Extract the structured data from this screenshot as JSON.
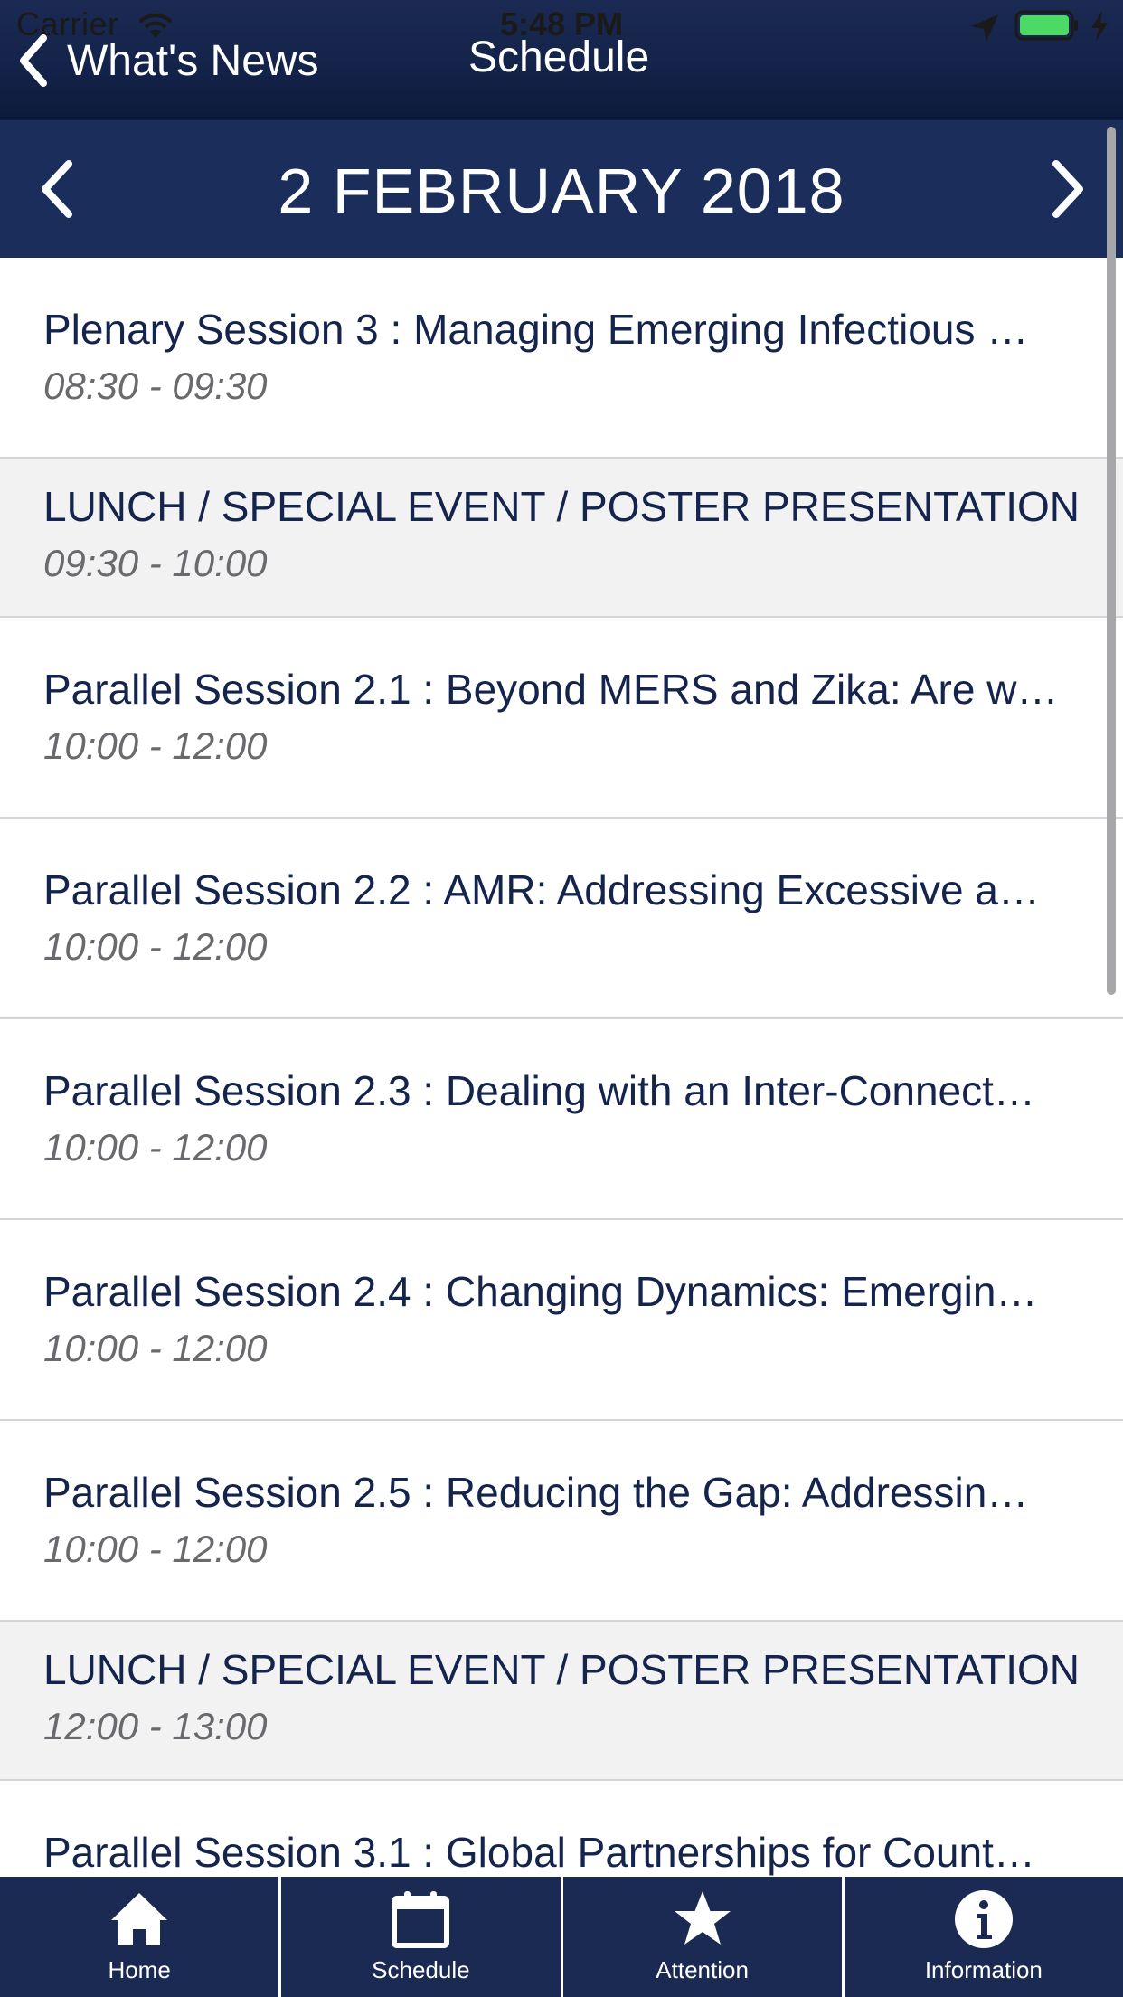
{
  "status_bar": {
    "carrier": "Carrier",
    "time": "5:48 PM",
    "battery_color": "#4cd964"
  },
  "nav": {
    "back_label": "What's News",
    "title": "Schedule",
    "back_icon": "chevron-left-icon"
  },
  "date_selector": {
    "label": "2 FEBRUARY 2018",
    "prev_icon": "chevron-left-icon",
    "next_icon": "chevron-right-icon"
  },
  "schedule": [
    {
      "kind": "session",
      "title": "Plenary Session 3 : Managing Emerging Infectious …",
      "time": "08:30 - 09:30"
    },
    {
      "kind": "break",
      "title": "LUNCH / SPECIAL EVENT / POSTER PRESENTATION",
      "time": "09:30 - 10:00"
    },
    {
      "kind": "session",
      "title": "Parallel Session 2.1 : Beyond MERS and Zika: Are w…",
      "time": "10:00 - 12:00"
    },
    {
      "kind": "session",
      "title": "Parallel Session 2.2 : AMR: Addressing Excessive a…",
      "time": "10:00 - 12:00"
    },
    {
      "kind": "session",
      "title": "Parallel Session 2.3 : Dealing with an Inter-Connect…",
      "time": "10:00 - 12:00"
    },
    {
      "kind": "session",
      "title": "Parallel Session 2.4 : Changing Dynamics: Emergin…",
      "time": "10:00 - 12:00"
    },
    {
      "kind": "session",
      "title": "Parallel Session 2.5 : Reducing the Gap: Addressin…",
      "time": "10:00 - 12:00"
    },
    {
      "kind": "break",
      "title": "LUNCH / SPECIAL EVENT / POSTER PRESENTATION",
      "time": "12:00 - 13:00"
    },
    {
      "kind": "session",
      "title": "Parallel Session 3.1 : Global Partnerships for Count…",
      "time": ""
    }
  ],
  "tabs": [
    {
      "label": "Home",
      "icon": "home-icon"
    },
    {
      "label": "Schedule",
      "icon": "calendar-icon"
    },
    {
      "label": "Attention",
      "icon": "star-icon"
    },
    {
      "label": "Information",
      "icon": "info-icon"
    }
  ],
  "colors": {
    "nav_bg": "#1b2a52",
    "date_bg": "#1b2d5a",
    "title_text": "#14244c",
    "time_text": "#6a6a6e",
    "break_row_bg": "#f2f2f3"
  }
}
